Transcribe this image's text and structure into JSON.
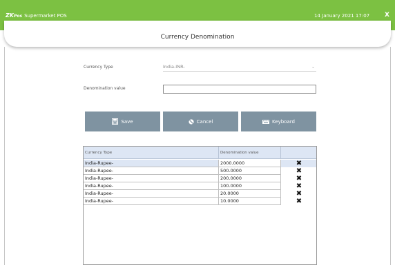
{
  "header": {
    "logo_brand": "ZK",
    "logo_mark": "Pos",
    "app_title": "Supermarket POS",
    "datetime": "14 January 2021 17:07",
    "close_label": "X",
    "bar_color": "#7cc142"
  },
  "page": {
    "title": "Currency Denomination"
  },
  "form": {
    "currency_type_label": "Currency Type",
    "currency_type_value": "India-INR-",
    "denomination_label": "Denomination value",
    "denomination_value": ""
  },
  "buttons": {
    "save": "Save",
    "cancel": "Cancel",
    "keyboard": "Keyboard",
    "color": "#7f93a1"
  },
  "table": {
    "columns": [
      "Currency Type",
      "Denomination value",
      ""
    ],
    "rows": [
      {
        "currency": "India-Rupee-",
        "value": "2000.0000",
        "selected": true
      },
      {
        "currency": "India-Rupee-",
        "value": "500.0000",
        "selected": false
      },
      {
        "currency": "India-Rupee-",
        "value": "200.0000",
        "selected": false
      },
      {
        "currency": "India-Rupee-",
        "value": "100.0000",
        "selected": false
      },
      {
        "currency": "India-Rupee-",
        "value": "20.0000",
        "selected": false
      },
      {
        "currency": "India-Rupee-",
        "value": "10.0000",
        "selected": false
      }
    ],
    "delete_icon": "delete-x-icon",
    "header_color": "#dde6f4"
  }
}
